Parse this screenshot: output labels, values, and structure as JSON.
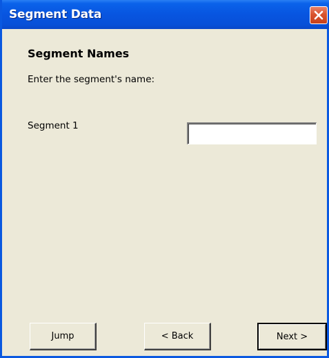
{
  "window": {
    "title": "Segment Data",
    "close_icon": "close-icon"
  },
  "content": {
    "heading": "Segment Names",
    "instruction": "Enter the segment's name:",
    "segment_label": "Segment 1",
    "segment_value": ""
  },
  "buttons": {
    "jump": "Jump",
    "back": "< Back",
    "next": "Next >"
  },
  "colors": {
    "titlebar": "#0855e0",
    "close": "#d9542e",
    "background": "#ece9d8"
  }
}
